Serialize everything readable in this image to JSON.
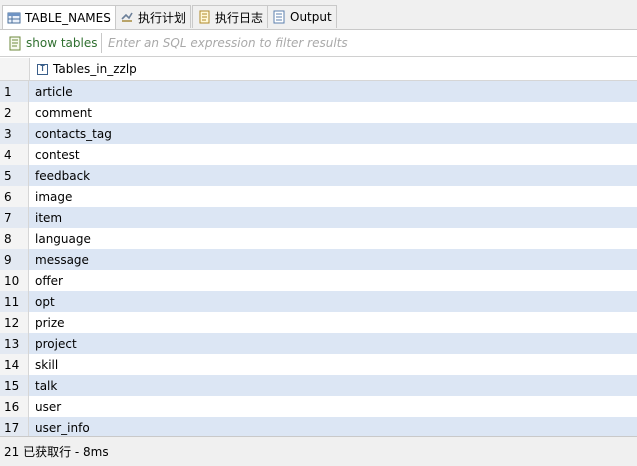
{
  "tabs": [
    {
      "label": "TABLE_NAMES",
      "icon": "table-grid-icon",
      "active": true
    },
    {
      "label": "执行计划",
      "icon": "explain-plan-icon",
      "active": false
    },
    {
      "label": "执行日志",
      "icon": "execution-log-icon",
      "active": false
    },
    {
      "label": "Output",
      "icon": "output-icon",
      "active": false
    }
  ],
  "toolbar": {
    "sql_label": "show tables",
    "filter_placeholder": "Enter an SQL expression to filter results"
  },
  "grid": {
    "column_header": "Tables_in_zzlp",
    "column_type_icon": "text-type-icon",
    "column_type_letter": "T",
    "rows": [
      {
        "num": "1",
        "value": "article"
      },
      {
        "num": "2",
        "value": "comment"
      },
      {
        "num": "3",
        "value": "contacts_tag"
      },
      {
        "num": "4",
        "value": "contest"
      },
      {
        "num": "5",
        "value": "feedback"
      },
      {
        "num": "6",
        "value": "image"
      },
      {
        "num": "7",
        "value": "item"
      },
      {
        "num": "8",
        "value": "language"
      },
      {
        "num": "9",
        "value": "message"
      },
      {
        "num": "10",
        "value": "offer"
      },
      {
        "num": "11",
        "value": "opt"
      },
      {
        "num": "12",
        "value": "prize"
      },
      {
        "num": "13",
        "value": "project"
      },
      {
        "num": "14",
        "value": "skill"
      },
      {
        "num": "15",
        "value": "talk"
      },
      {
        "num": "16",
        "value": "user"
      },
      {
        "num": "17",
        "value": "user_info"
      }
    ]
  },
  "status": {
    "text": "21 已获取行 - 8ms"
  },
  "colors": {
    "row_stripe": "#dce6f4",
    "sql_label": "#2f6f2f",
    "placeholder": "#a9a9a9"
  }
}
